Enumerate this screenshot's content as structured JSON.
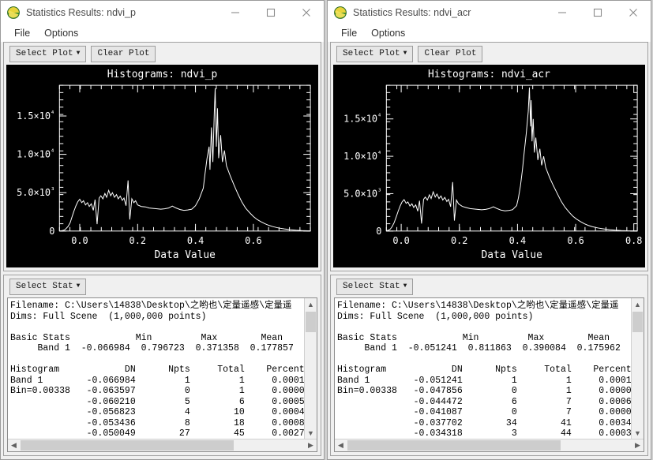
{
  "windows": [
    {
      "id": "left",
      "title": "Statistics Results: ndvi_p",
      "icon": "envi-globe-icon",
      "menu": [
        "File",
        "Options"
      ],
      "toolbar": {
        "select_plot": "Select Plot",
        "clear_plot": "Clear Plot",
        "select_stat": "Select Stat",
        "caret": "▼"
      },
      "stats_text": {
        "filename_label": "Filename: ",
        "filename_value": "C:\\Users\\14838\\Desktop\\",
        "filename_cjk": "之哟也",
        "filename_sep1": "\\",
        "filename_cjk2": "定量遥感",
        "filename_sep2": "\\",
        "filename_cjk3": "定量遥",
        "dims": "Dims: Full Scene  (1,000,000 points)",
        "basic_header": "Basic Stats            Min         Max        Mean       Stdev",
        "basic_row": "     Band 1  -0.066984  0.796723  0.371358  0.177857",
        "hist_header": "Histogram            DN      Npts     Total    Percent    A",
        "hist_rows": [
          "Band 1        -0.066984         1         1     0.0001",
          "Bin=0.00338   -0.063597         0         1     0.0000",
          "              -0.060210         5         6     0.0005",
          "              -0.056823         4        10     0.0004",
          "              -0.053436         8        18     0.0008",
          "              -0.050049        27        45     0.0027"
        ]
      },
      "chart_data": {
        "type": "line",
        "title": "Histograms: ndvi_p",
        "xlabel": "Data Value",
        "ylabel": "",
        "xlim": [
          -0.07,
          0.797
        ],
        "ylim": [
          0,
          19000
        ],
        "xticks": [
          0.0,
          0.2,
          0.4,
          0.6
        ],
        "xticklabels": [
          "0.0",
          "0.2",
          "0.4",
          "0.6"
        ],
        "yticks": [
          0,
          5000,
          10000,
          15000
        ],
        "yticklabels": [
          "0",
          "5.0×10³",
          "1.0×10⁴",
          "1.5×10⁴"
        ],
        "grid": false,
        "legend": "none",
        "line_color": "#ffffff",
        "bg_color": "#000000",
        "peak_x": 0.468,
        "peak_y": 18600,
        "series": [
          {
            "name": "ndvi_p",
            "x": [
              -0.067,
              -0.06,
              -0.053,
              -0.047,
              -0.04,
              -0.033,
              -0.027,
              -0.02,
              -0.013,
              -0.007,
              0.0,
              0.007,
              0.013,
              0.02,
              0.027,
              0.033,
              0.04,
              0.047,
              0.053,
              0.06,
              0.067,
              0.073,
              0.08,
              0.087,
              0.093,
              0.1,
              0.107,
              0.113,
              0.12,
              0.127,
              0.133,
              0.14,
              0.147,
              0.153,
              0.16,
              0.167,
              0.173,
              0.18,
              0.187,
              0.193,
              0.2,
              0.213,
              0.227,
              0.24,
              0.253,
              0.267,
              0.28,
              0.293,
              0.307,
              0.32,
              0.333,
              0.347,
              0.36,
              0.373,
              0.387,
              0.4,
              0.413,
              0.427,
              0.433,
              0.44,
              0.447,
              0.45,
              0.455,
              0.46,
              0.465,
              0.468,
              0.472,
              0.476,
              0.48,
              0.487,
              0.493,
              0.5,
              0.507,
              0.52,
              0.533,
              0.547,
              0.56,
              0.573,
              0.587,
              0.6,
              0.613,
              0.627,
              0.64,
              0.653,
              0.667,
              0.687,
              0.707,
              0.727,
              0.747,
              0.767,
              0.797
            ],
            "y": [
              20,
              60,
              140,
              330,
              620,
              1100,
              1800,
              2600,
              3300,
              3800,
              4150,
              3700,
              3950,
              3400,
              3700,
              3200,
              3550,
              2700,
              4100,
              900,
              4300,
              4600,
              4200,
              4900,
              4400,
              5300,
              4600,
              5000,
              4400,
              4750,
              4200,
              4550,
              4000,
              4300,
              3300,
              6600,
              1500,
              4200,
              3700,
              3950,
              3400,
              3200,
              3150,
              3000,
              2950,
              2900,
              2850,
              2900,
              3000,
              3250,
              3000,
              2800,
              2700,
              2750,
              2850,
              3300,
              4200,
              5600,
              7500,
              9500,
              11000,
              8000,
              13500,
              9000,
              15500,
              18600,
              11000,
              16000,
              9500,
              12500,
              9000,
              10500,
              8500,
              7200,
              6000,
              4800,
              3800,
              3000,
              2400,
              1900,
              1500,
              1200,
              950,
              750,
              580,
              400,
              280,
              180,
              110,
              60,
              20
            ]
          }
        ]
      }
    },
    {
      "id": "right",
      "title": "Statistics Results: ndvi_acr",
      "icon": "envi-globe-icon",
      "menu": [
        "File",
        "Options"
      ],
      "toolbar": {
        "select_plot": "Select Plot",
        "clear_plot": "Clear Plot",
        "select_stat": "Select Stat",
        "caret": "▼"
      },
      "stats_text": {
        "filename_label": "Filename: ",
        "filename_value": "C:\\Users\\14838\\Desktop\\",
        "filename_cjk": "之哟也",
        "filename_sep1": "\\",
        "filename_cjk2": "定量遥感",
        "filename_sep2": "\\",
        "filename_cjk3": "定量遥",
        "dims": "Dims: Full Scene  (1,000,000 points)",
        "basic_header": "Basic Stats            Min         Max        Mean       Stdev",
        "basic_row": "     Band 1  -0.051241  0.811863  0.390084  0.175962",
        "hist_header": "Histogram            DN      Npts     Total    Percent    A",
        "hist_rows": [
          "Band 1        -0.051241         1         1     0.0001",
          "Bin=0.00338   -0.047856         0         1     0.0000",
          "              -0.044472         6         7     0.0006",
          "              -0.041087         0         7     0.0000",
          "              -0.037702        34        41     0.0034",
          "              -0.034318         3        44     0.0003"
        ]
      },
      "chart_data": {
        "type": "line",
        "title": "Histograms: ndvi_acr",
        "xlabel": "Data Value",
        "ylabel": "",
        "xlim": [
          -0.051,
          0.812
        ],
        "ylim": [
          0,
          19500
        ],
        "xticks": [
          0.0,
          0.2,
          0.4,
          0.6,
          0.8
        ],
        "xticklabels": [
          "0.0",
          "0.2",
          "0.4",
          "0.6",
          "0.8"
        ],
        "yticks": [
          0,
          5000,
          10000,
          15000
        ],
        "yticklabels": [
          "0",
          "5.0×10³",
          "1.0×10⁴",
          "1.5×10⁴"
        ],
        "grid": false,
        "legend": "none",
        "line_color": "#ffffff",
        "bg_color": "#000000",
        "peak_x": 0.447,
        "peak_y": 19200,
        "series": [
          {
            "name": "ndvi_acr",
            "x": [
              -0.051,
              -0.044,
              -0.037,
              -0.031,
              -0.024,
              -0.017,
              -0.01,
              -0.003,
              0.003,
              0.01,
              0.017,
              0.023,
              0.03,
              0.037,
              0.043,
              0.05,
              0.057,
              0.063,
              0.07,
              0.077,
              0.083,
              0.09,
              0.097,
              0.103,
              0.11,
              0.117,
              0.123,
              0.13,
              0.137,
              0.143,
              0.15,
              0.157,
              0.163,
              0.17,
              0.177,
              0.183,
              0.19,
              0.197,
              0.21,
              0.223,
              0.237,
              0.25,
              0.263,
              0.277,
              0.29,
              0.303,
              0.317,
              0.33,
              0.343,
              0.357,
              0.37,
              0.383,
              0.397,
              0.403,
              0.41,
              0.417,
              0.423,
              0.43,
              0.437,
              0.441,
              0.445,
              0.447,
              0.45,
              0.454,
              0.458,
              0.463,
              0.47,
              0.477,
              0.483,
              0.49,
              0.497,
              0.51,
              0.523,
              0.537,
              0.55,
              0.563,
              0.577,
              0.59,
              0.603,
              0.617,
              0.63,
              0.643,
              0.657,
              0.677,
              0.697,
              0.717,
              0.737,
              0.757,
              0.777,
              0.812
            ],
            "y": [
              30,
              110,
              280,
              600,
              1150,
              1900,
              2700,
              3400,
              3900,
              4200,
              3700,
              3900,
              3350,
              3650,
              3150,
              3500,
              2650,
              4050,
              1000,
              4250,
              4550,
              4150,
              4850,
              4350,
              5250,
              4550,
              4950,
              4350,
              4700,
              4150,
              4500,
              3950,
              4250,
              3250,
              6550,
              1400,
              4150,
              3650,
              3300,
              3150,
              3000,
              2950,
              2900,
              2850,
              2900,
              3000,
              3250,
              3000,
              2800,
              2700,
              2750,
              2850,
              3400,
              4400,
              6000,
              8200,
              10500,
              13000,
              16000,
              19200,
              14000,
              17500,
              12000,
              15000,
              10500,
              12500,
              9500,
              11000,
              8800,
              10000,
              8500,
              7200,
              6100,
              5000,
              4000,
              3200,
              2550,
              2000,
              1600,
              1250,
              980,
              760,
              590,
              410,
              280,
              180,
              110,
              60,
              30,
              15
            ]
          }
        ]
      }
    }
  ]
}
